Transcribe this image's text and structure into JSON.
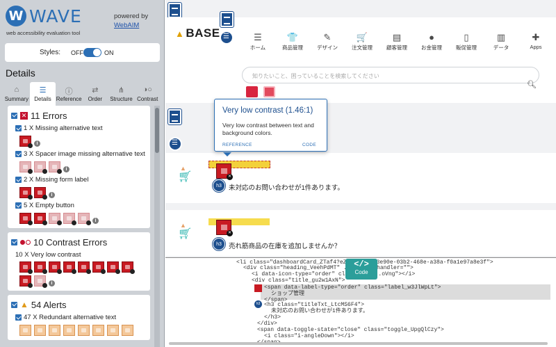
{
  "wave": {
    "logo_letter": "W",
    "brand": "WAVE",
    "tagline": "web accessibility evaluation tool",
    "powered_by": "powered by",
    "powered_link": "WebAIM",
    "styles_label": "Styles:",
    "styles_off": "OFF",
    "styles_on": "ON",
    "details_title": "Details",
    "tabs": [
      {
        "label": "Summary",
        "icon": "home-icon"
      },
      {
        "label": "Details",
        "icon": "list-icon"
      },
      {
        "label": "Reference",
        "icon": "info-icon"
      },
      {
        "label": "Order",
        "icon": "order-icon"
      },
      {
        "label": "Structure",
        "icon": "structure-icon"
      },
      {
        "label": "Contrast",
        "icon": "contrast-icon"
      }
    ],
    "errors": {
      "heading": "11 Errors",
      "items": [
        {
          "label": "1 X Missing alternative text"
        },
        {
          "label": "3 X Spacer image missing alternative text"
        },
        {
          "label": "2 X Missing form label"
        },
        {
          "label": "5 X Empty button"
        }
      ]
    },
    "contrast": {
      "heading": "10 Contrast Errors",
      "sub": "10 X Very low contrast"
    },
    "alerts": {
      "heading": "54 Alerts",
      "sub": "47 X Redundant alternative text"
    }
  },
  "site": {
    "logo": "BASE",
    "nav": [
      {
        "label": "ホーム",
        "icon": "home-icon"
      },
      {
        "label": "商品管理",
        "icon": "shirt-icon"
      },
      {
        "label": "デザイン",
        "icon": "brush-icon"
      },
      {
        "label": "注文管理",
        "icon": "cart-icon"
      },
      {
        "label": "顧客管理",
        "icon": "customer-icon"
      },
      {
        "label": "お金管理",
        "icon": "money-icon"
      },
      {
        "label": "販促管理",
        "icon": "phone-icon"
      },
      {
        "label": "データ",
        "icon": "chart-icon"
      },
      {
        "label": "Apps",
        "icon": "puzzle-icon"
      }
    ],
    "search_placeholder": "知りたいこと、困っていることを検索してください",
    "card1_text": "未対応のお問い合わせが1件あります。",
    "card2_text": "売れ筋商品の在庫を追加しませんか？",
    "h3_label": "h3"
  },
  "tooltip": {
    "title": "Very low contrast (1.46:1)",
    "body": "Very low contrast between text and background colors.",
    "reference": "REFERENCE",
    "code": "CODE"
  },
  "code": {
    "badge_symbol": "</>",
    "badge_label": "Code",
    "lines": [
      "<li class=\"dashboardCard_ZTaf4?eZ\" ... bu53e90e-03b2-468e-a38a-f0a1e97a8e3f\">",
      "<div class=\"heading_VeehPdMT\" ... click-handler=\"\">",
      "<i data-icon-type=\"order\" class=\"ico...oVng\"></i>",
      "<div class=\"title_gu2w1AxN\">",
      "<span data-label-type=\"order\" class=\"label_w3JlWpLt\">",
      "ショップ管理",
      "</span>",
      "<h3 class=\"titleTxt_LtcMS6F4\">",
      "未対応のお問い合わせが1件あります。",
      "</h3>",
      "</div>",
      "<span data-toggle-state=\"close\" class=\"toggle_UpgQlCzy\">",
      "<i class=\"i-angleDown\"></i>",
      "</span>"
    ]
  }
}
